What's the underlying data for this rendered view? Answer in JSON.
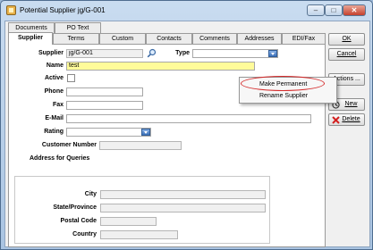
{
  "window": {
    "title": "Potential Supplier  jg/G-001",
    "minimize": "–",
    "maximize": "□",
    "close": "✕"
  },
  "tabs": {
    "row1": [
      "Documents",
      "PO Text"
    ],
    "row2": [
      "Supplier",
      "Terms",
      "Custom",
      "Contacts",
      "Comments",
      "Addresses",
      "EDI/Fax"
    ],
    "active": "Supplier"
  },
  "form": {
    "supplier_label": "Supplier",
    "supplier_value": "jg/G-001",
    "type_label": "Type",
    "type_value": "",
    "name_label": "Name",
    "name_value": "test",
    "active_label": "Active",
    "phone_label": "Phone",
    "phone_value": "",
    "fax_label": "Fax",
    "fax_value": "",
    "email_label": "E-Mail",
    "email_value": "",
    "rating_label": "Rating",
    "rating_value": "",
    "customer_number_label": "Customer Number",
    "customer_number_value": ""
  },
  "address": {
    "group_title": "Address for Queries",
    "city_label": "City",
    "state_label": "State/Province",
    "postal_label": "Postal Code",
    "country_label": "Country"
  },
  "buttons": {
    "ok": "OK",
    "cancel": "Cancel",
    "actions": "Actions ...",
    "new": "New",
    "delete": "Delete"
  },
  "context_menu": {
    "items": [
      "Make Permanent",
      "Rename Supplier"
    ]
  },
  "colors": {
    "name_highlight": "#fffb9a",
    "annotation_ring": "#d42a2a"
  }
}
